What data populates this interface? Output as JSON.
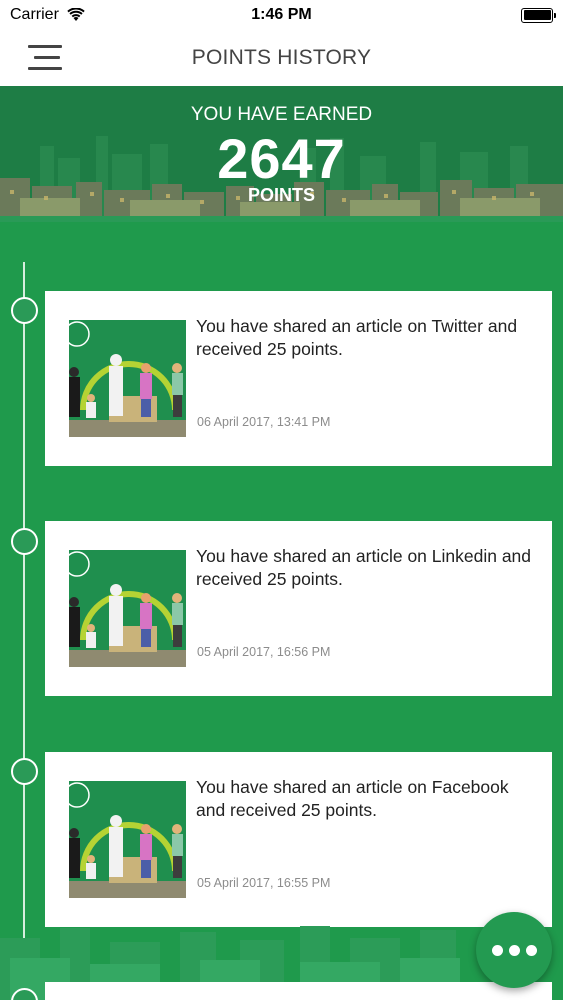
{
  "status_bar": {
    "carrier": "Carrier",
    "time": "1:46 PM"
  },
  "nav": {
    "title": "POINTS HISTORY",
    "menu_icon": "hamburger-menu-icon"
  },
  "summary": {
    "earned_label": "YOU HAVE EARNED",
    "points": "2647",
    "points_label": "POINTS"
  },
  "history": [
    {
      "text": "You have shared an article on Twitter and received 25 points.",
      "date": "06 April 2017, 13:41 PM"
    },
    {
      "text": "You have shared an article on Linkedin and received 25 points.",
      "date": "05 April 2017, 16:56 PM"
    },
    {
      "text": "You have shared an article on Facebook and received 25 points.",
      "date": "05 April 2017, 16:55 PM"
    }
  ],
  "fab": {
    "icon": "more-dots-icon"
  },
  "colors": {
    "primary_green": "#1f9a4c",
    "dark_green": "#1e7d45",
    "card_bg": "#ffffff",
    "date_gray": "#8c8c8c"
  }
}
